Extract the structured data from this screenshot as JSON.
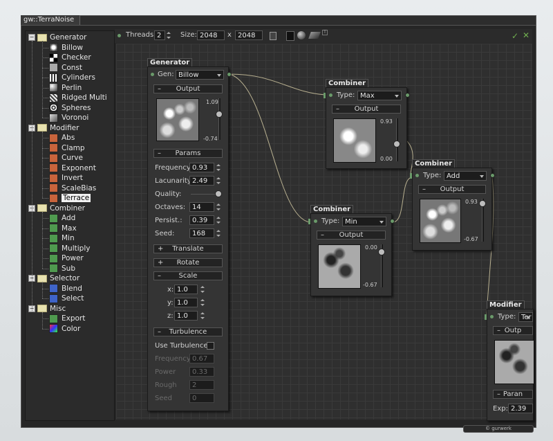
{
  "window": {
    "title": "gw::TerraNoise"
  },
  "tree": {
    "groups": [
      {
        "label": "Generator",
        "items": [
          "Billow",
          "Checker",
          "Const",
          "Cylinders",
          "Perlin",
          "Ridged Multi",
          "Spheres",
          "Voronoi"
        ]
      },
      {
        "label": "Modifier",
        "items": [
          "Abs",
          "Clamp",
          "Curve",
          "Exponent",
          "Invert",
          "ScaleBias",
          "Terrace"
        ]
      },
      {
        "label": "Combiner",
        "items": [
          "Add",
          "Max",
          "Min",
          "Multiply",
          "Power",
          "Sub"
        ]
      },
      {
        "label": "Selector",
        "items": [
          "Blend",
          "Select"
        ]
      },
      {
        "label": "Misc",
        "items": [
          "Export",
          "Color"
        ]
      }
    ],
    "selected": "Terrace"
  },
  "toolbar": {
    "threads_label": "Threads:",
    "threads_value": "2",
    "size_label": "Size:",
    "size_w": "2048",
    "size_sep": "x",
    "size_h": "2048",
    "ok_icon": "check-icon",
    "close_icon": "close-icon"
  },
  "generator": {
    "title": "Generator",
    "gen_label": "Gen:",
    "gen_value": "Billow",
    "output_label": "Output",
    "out_max": "1.09",
    "out_min": "-0.74",
    "params_label": "Params",
    "frequency_label": "Frequency:",
    "frequency": "0.93",
    "lacunarity_label": "Lacunarity:",
    "lacunarity": "2.49",
    "quality_label": "Quality:",
    "octaves_label": "Octaves:",
    "octaves": "14",
    "persist_label": "Persist.:",
    "persist": "0.39",
    "seed_label": "Seed:",
    "seed": "168",
    "translate_label": "Translate",
    "rotate_label": "Rotate",
    "scale_label": "Scale",
    "x_label": "x:",
    "x": "1.0",
    "y_label": "y:",
    "y": "1.0",
    "z_label": "z:",
    "z": "1.0",
    "turbulence_label": "Turbulence",
    "use_turbulence_label": "Use Turbulence",
    "t_frequency_label": "Frequency",
    "t_frequency": "0.67",
    "t_power_label": "Power",
    "t_power": "0.33",
    "t_rough_label": "Rough",
    "t_rough": "2",
    "t_seed_label": "Seed",
    "t_seed": "0"
  },
  "combiner_max": {
    "title": "Combiner",
    "type_label": "Type:",
    "type_value": "Max",
    "output_label": "Output",
    "out_max": "0.93",
    "out_min": "0.00"
  },
  "combiner_min": {
    "title": "Combiner",
    "type_label": "Type:",
    "type_value": "Min",
    "output_label": "Output",
    "out_max": "0.00",
    "out_min": "-0.67"
  },
  "combiner_add": {
    "title": "Combiner",
    "type_label": "Type:",
    "type_value": "Add",
    "output_label": "Output",
    "out_max": "0.93",
    "out_min": "-0.67"
  },
  "modifier": {
    "title": "Modifier",
    "type_label": "Type:",
    "type_value": "Ter",
    "output_label": "Outp",
    "params_label": "Paran",
    "exp_label": "Exp:",
    "exp": "2.39"
  },
  "footer": {
    "logo": "© gurwerk"
  }
}
